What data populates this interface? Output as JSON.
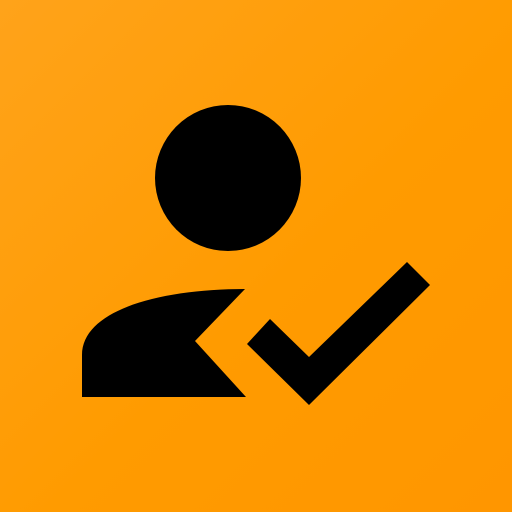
{
  "icon": {
    "name": "user-check-icon",
    "background_color": "#ff9a00",
    "foreground_color": "#000000"
  }
}
